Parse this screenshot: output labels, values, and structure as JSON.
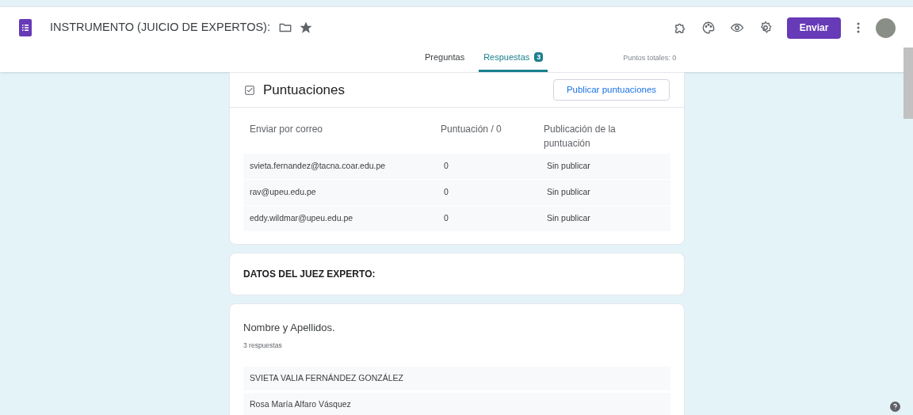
{
  "header": {
    "title": "INSTRUMENTO (JUICIO DE EXPERTOS):",
    "send_button": "Enviar"
  },
  "tabs": [
    {
      "label": "Preguntas",
      "selected": false
    },
    {
      "label": "Respuestas",
      "selected": true,
      "badge": "3"
    }
  ],
  "total_points": "Puntos totales: 0",
  "scores": {
    "title": "Puntuaciones",
    "publish_button": "Publicar puntuaciones",
    "columns": [
      "Enviar por correo",
      "Puntuación / 0",
      "Publicación de la puntuación"
    ],
    "rows": [
      [
        "svieta.fernandez@tacna.coar.edu.pe",
        "0",
        "Sin publicar"
      ],
      [
        "rav@upeu.edu.pe",
        "0",
        "Sin publicar"
      ],
      [
        "eddy.wildmar@upeu.edu.pe",
        "0",
        "Sin publicar"
      ]
    ]
  },
  "section": {
    "title": "DATOS DEL JUEZ EXPERTO:"
  },
  "question": {
    "title": "Nombre y Apellidos.",
    "count": "3 respuestas",
    "answers": [
      "SVIETA VALIA FERNÁNDEZ GONZÁLEZ",
      "Rosa María Alfaro Vásquez"
    ]
  }
}
